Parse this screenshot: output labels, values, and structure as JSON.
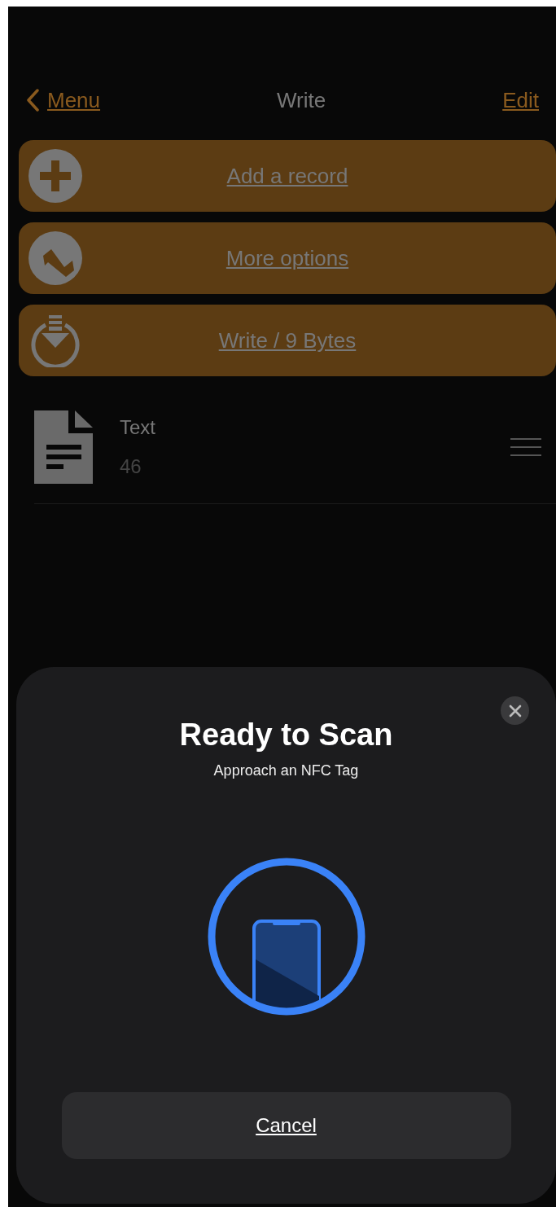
{
  "nav": {
    "back_label": "Menu",
    "title": "Write",
    "edit_label": "Edit"
  },
  "actions": [
    {
      "kind": "add",
      "label": "Add a record"
    },
    {
      "kind": "options",
      "label": "More options"
    },
    {
      "kind": "write",
      "label": "Write / 9 Bytes"
    }
  ],
  "records": [
    {
      "type": "Text",
      "size": "46"
    }
  ],
  "sheet": {
    "title": "Ready to Scan",
    "subtitle": "Approach an NFC Tag",
    "cancel": "Cancel"
  }
}
